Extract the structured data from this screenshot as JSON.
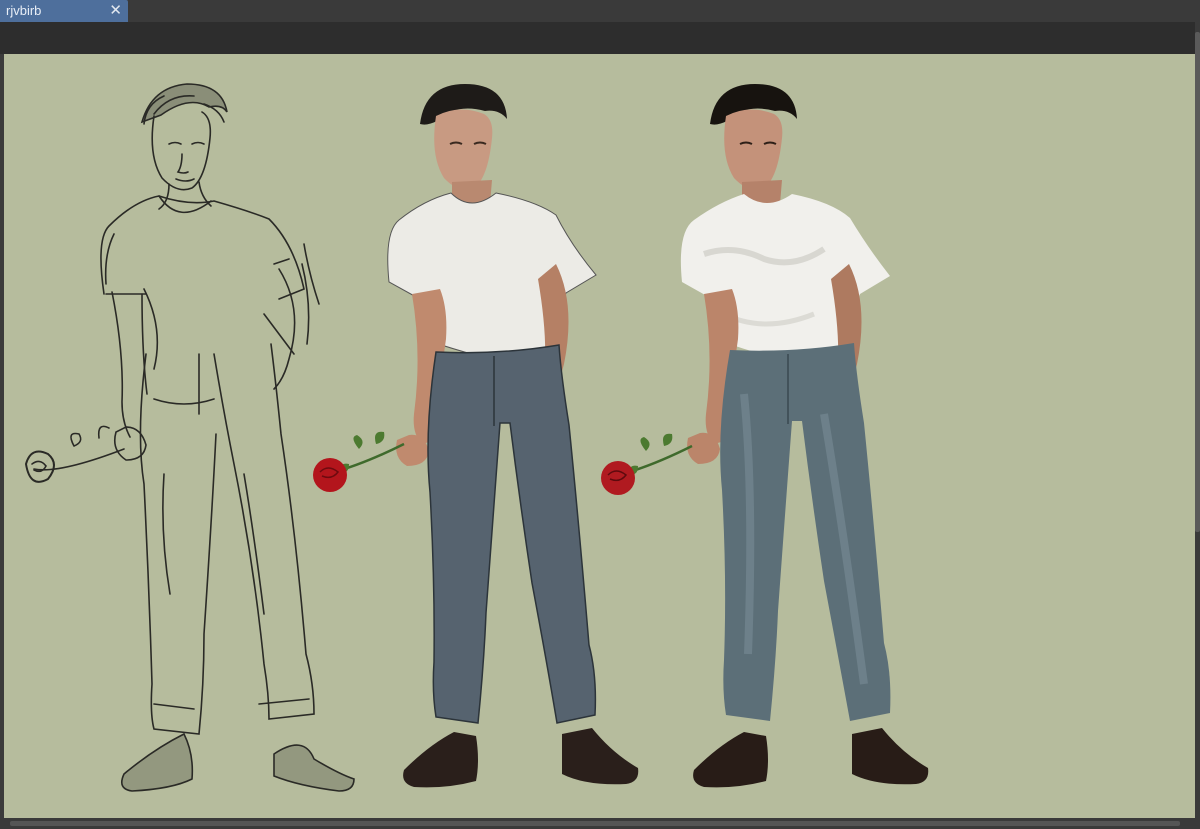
{
  "document_tab": {
    "title": "rjvbirb",
    "close_icon": "close-icon"
  },
  "canvas": {
    "background_color": "#b6bc9d",
    "figures": [
      {
        "stage": "sketch"
      },
      {
        "stage": "flat-color"
      },
      {
        "stage": "rendered"
      }
    ]
  },
  "colors": {
    "tab_active": "#4e6f9c",
    "chrome_dark": "#2d2d2d",
    "rose_red": "#b3151c",
    "jeans_flat": "#56636f",
    "jeans_rendered": "#5c6f78",
    "shirt_white": "#ecebe6"
  }
}
